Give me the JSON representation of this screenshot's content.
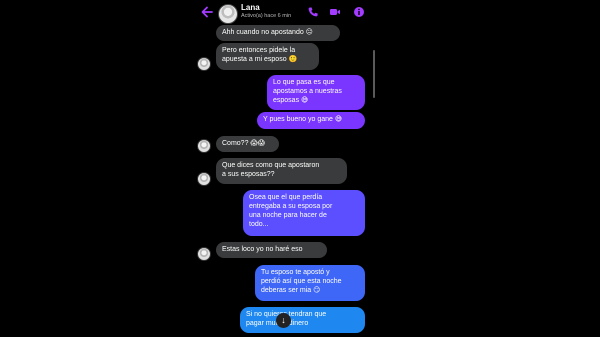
{
  "header": {
    "contact_name": "Lana",
    "status": "Activo(a) hace 6 min",
    "accent_color": "#a33cff",
    "icons": [
      "back-arrow-icon",
      "phone-icon",
      "video-camera-icon",
      "info-icon"
    ]
  },
  "messages": [
    {
      "side": "in",
      "text": "Ahh cuando no apostando 😑"
    },
    {
      "side": "in",
      "text": "Pero entonces pidele la\napuesta a mi esposo 🙂"
    },
    {
      "side": "out",
      "text": "Lo que pasa es que\napostamos a nuestras\nesposas 😅"
    },
    {
      "side": "out",
      "text": "Y pues bueno yo gane 😅"
    },
    {
      "side": "in",
      "text": "Como?? 😱😱"
    },
    {
      "side": "in",
      "text": "Que dices como que apostaron\na sus esposas??"
    },
    {
      "side": "out",
      "text": "Osea que el que perdía\nentregaba a su esposa por\nuna noche para hacer de\ntodo..."
    },
    {
      "side": "in",
      "text": "Estas loco yo no haré eso"
    },
    {
      "side": "out",
      "text": "Tu esposo te apostó y\nperdió así que esta noche\ndeberas ser mia 😏"
    },
    {
      "side": "out",
      "text": "Si no quieres tendran que\npagar mucho dinero"
    }
  ],
  "scroll_button": {
    "icon": "arrow-down-icon",
    "glyph": "↓"
  }
}
